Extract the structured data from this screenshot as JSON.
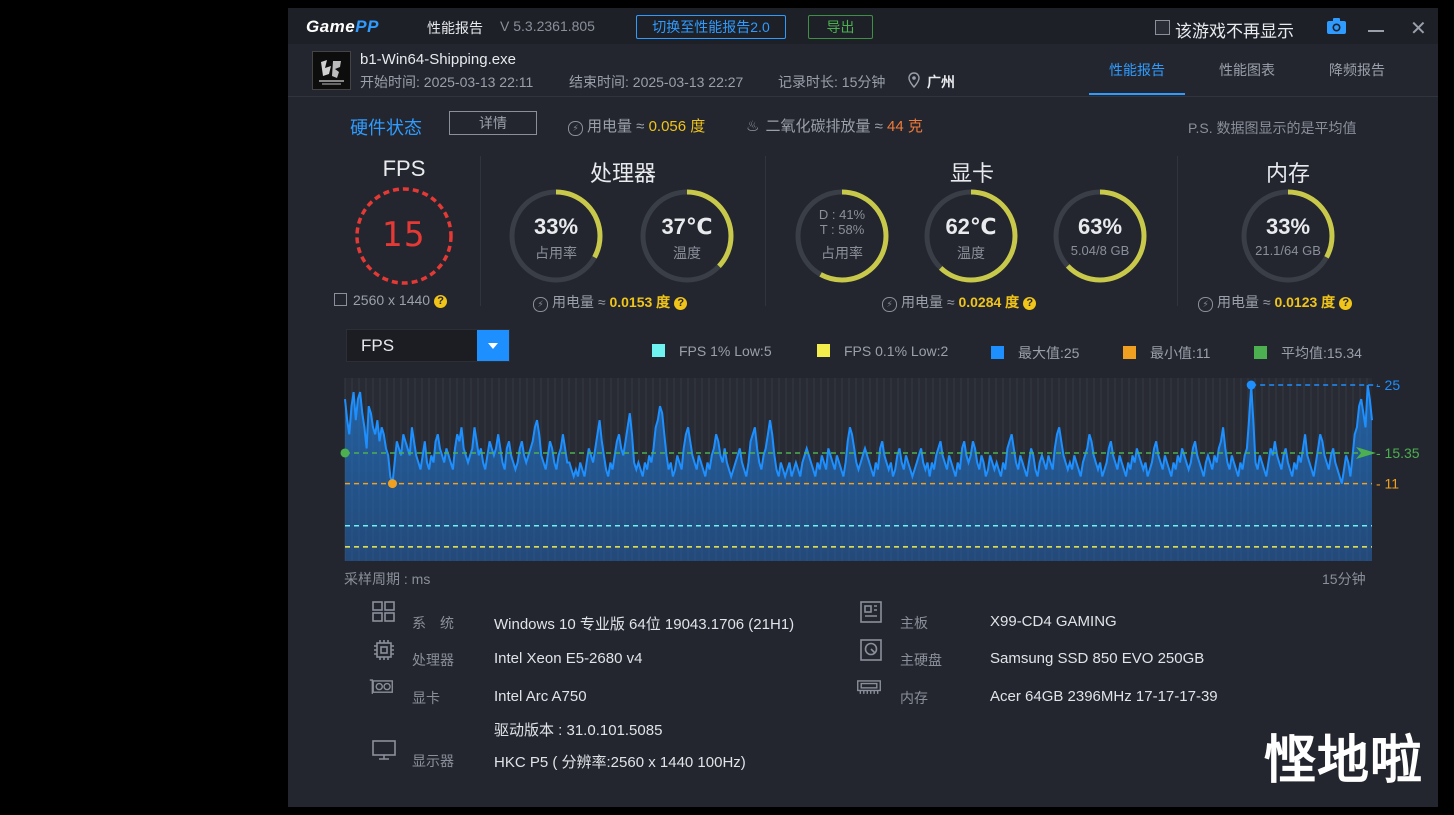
{
  "app": {
    "logo_a": "Game",
    "logo_b": "PP",
    "title": "性能报告",
    "version": "V 5.3.2361.805",
    "switch_label": "切换至性能报告2.0",
    "export_label": "导出",
    "hide_label": "该游戏不再显示",
    "close_glyph": "✕"
  },
  "game": {
    "name": "b1-Win64-Shipping.exe",
    "start": "开始时间: 2025-03-13 22:11",
    "end": "结束时间: 2025-03-13 22:27",
    "duration": "记录时长: 15分钟",
    "location": "广州"
  },
  "tabs": [
    {
      "label": "性能报告",
      "active": true
    },
    {
      "label": "性能图表",
      "active": false
    },
    {
      "label": "降频报告",
      "active": false
    }
  ],
  "hardware": {
    "title": "硬件状态",
    "detail_label": "详情",
    "power_prefix": "用电量 ≈ ",
    "power_value": "0.056 度",
    "co2_prefix": "二氧化碳排放量 ≈ ",
    "co2_value": "44 克",
    "note": "P.S. 数据图显示的是平均值"
  },
  "fps_panel": {
    "title": "FPS",
    "value": "15",
    "resolution": "2560 x 1440"
  },
  "cpu_panel": {
    "title": "处理器",
    "usage_value": "33%",
    "usage_label": "占用率",
    "usage_frac": 0.33,
    "temp_value": "37℃",
    "temp_label": "温度",
    "temp_frac": 0.37,
    "power_prefix": "用电量 ≈ ",
    "power_value": "0.0153 度"
  },
  "gpu_panel": {
    "title": "显卡",
    "d_usage": "D : 41%",
    "t_usage": "T : 58%",
    "usage_label": "占用率",
    "usage_frac": 0.58,
    "temp_value": "62℃",
    "temp_label": "温度",
    "temp_frac": 0.62,
    "mem_value": "63%",
    "mem_label": "5.04/8 GB",
    "mem_frac": 0.63,
    "power_prefix": "用电量 ≈ ",
    "power_value": "0.0284 度"
  },
  "mem_panel": {
    "title": "内存",
    "value": "33%",
    "label": "21.1/64 GB",
    "frac": 0.33,
    "power_prefix": "用电量 ≈ ",
    "power_value": "0.0123 度"
  },
  "chart_select": {
    "value": "FPS"
  },
  "legend": [
    {
      "label": "FPS 1% Low:5",
      "color": "#6ff3f0"
    },
    {
      "label": "FPS 0.1% Low:2",
      "color": "#f4ee4c"
    },
    {
      "label": "最大值:25",
      "color": "#1e8fff"
    },
    {
      "label": "最小值:11",
      "color": "#f0a020"
    },
    {
      "label": "平均值:15.34",
      "color": "#4caf50"
    }
  ],
  "chart_data": {
    "type": "area",
    "title": "",
    "xlabel": "采样周期 : ms",
    "x_end_label": "15分钟",
    "ylim": [
      0,
      26
    ],
    "marker_labels": {
      "max": "25",
      "avg": "15.35",
      "min": "11"
    },
    "reference_lines": {
      "max": 25,
      "avg": 15.35,
      "min": 11,
      "low1": 5,
      "low01": 2
    },
    "colors": {
      "line": "#1e8fff",
      "avg": "#4caf50",
      "min": "#f0a020",
      "low1": "#6ff3f0",
      "low01": "#f4ee4c"
    },
    "values": [
      23,
      20,
      18,
      22,
      24,
      20,
      23,
      24,
      21,
      19,
      16,
      22,
      21,
      19,
      18,
      20,
      17,
      19,
      18,
      16,
      15,
      12,
      11,
      14,
      17,
      16,
      15,
      18,
      17,
      16,
      15,
      19,
      17,
      15,
      14,
      13,
      15,
      17,
      14,
      13,
      15,
      14,
      17,
      18,
      16,
      15,
      14,
      16,
      15,
      14,
      13,
      16,
      18,
      17,
      19,
      16,
      15,
      14,
      15,
      16,
      19,
      17,
      15,
      16,
      14,
      13,
      15,
      17,
      16,
      15,
      16,
      18,
      16,
      14,
      13,
      16,
      17,
      15,
      14,
      13,
      14,
      16,
      17,
      15,
      14,
      15,
      16,
      17,
      19,
      20,
      18,
      15,
      14,
      13,
      15,
      17,
      16,
      14,
      13,
      15,
      16,
      18,
      16,
      14,
      14,
      13,
      12,
      13,
      12,
      14,
      13,
      12,
      14,
      16,
      15,
      14,
      16,
      18,
      20,
      17,
      15,
      13,
      12,
      14,
      13,
      15,
      17,
      18,
      16,
      15,
      17,
      19,
      21,
      18,
      14,
      13,
      14,
      13,
      12,
      14,
      13,
      15,
      14,
      16,
      19,
      20,
      22,
      21,
      18,
      15,
      13,
      14,
      12,
      13,
      15,
      14,
      13,
      16,
      18,
      19,
      17,
      15,
      14,
      13,
      15,
      14,
      13,
      12,
      14,
      13,
      15,
      16,
      18,
      17,
      15,
      14,
      16,
      14,
      13,
      12,
      13,
      14,
      15,
      16,
      14,
      13,
      12,
      14,
      17,
      18,
      19,
      16,
      14,
      13,
      15,
      16,
      18,
      20,
      18,
      15,
      13,
      12,
      14,
      13,
      12,
      13,
      14,
      12,
      13,
      14,
      13,
      12,
      14,
      15,
      16,
      15,
      14,
      13,
      12,
      14,
      13,
      15,
      14,
      13,
      16,
      15,
      14,
      13,
      15,
      14,
      13,
      12,
      14,
      17,
      19,
      18,
      16,
      14,
      13,
      14,
      15,
      16,
      15,
      14,
      13,
      12,
      14,
      13,
      16,
      17,
      15,
      14,
      13,
      14,
      12,
      13,
      15,
      16,
      14,
      13,
      15,
      14,
      13,
      12,
      13,
      14,
      15,
      16,
      14,
      13,
      14,
      12,
      14,
      13,
      15,
      16,
      17,
      15,
      14,
      13,
      15,
      14,
      13,
      12,
      14,
      13,
      16,
      17,
      15,
      14,
      15,
      17,
      16,
      14,
      13,
      15,
      14,
      12,
      13,
      15,
      14,
      13,
      14,
      13,
      12,
      14,
      13,
      16,
      17,
      18,
      16,
      14,
      13,
      15,
      14,
      13,
      12,
      14,
      16,
      15,
      13,
      12,
      14,
      15,
      14,
      13,
      15,
      14,
      13,
      16,
      18,
      19,
      17,
      15,
      14,
      13,
      14,
      13,
      15,
      14,
      13,
      12,
      14,
      15,
      16,
      18,
      17,
      15,
      14,
      13,
      14,
      12,
      13,
      14,
      16,
      17,
      15,
      14,
      13,
      15,
      14,
      13,
      12,
      14,
      13,
      15,
      14,
      16,
      15,
      14,
      13,
      14,
      12,
      13,
      14,
      16,
      17,
      15,
      14,
      13,
      15,
      14,
      13,
      12,
      14,
      13,
      15,
      14,
      16,
      15,
      14,
      13,
      14,
      16,
      17,
      15,
      14,
      13,
      12,
      14,
      15,
      14,
      13,
      15,
      14,
      16,
      17,
      19,
      16,
      14,
      13,
      15,
      14,
      13,
      12,
      14,
      13,
      15,
      16,
      20,
      25,
      20,
      14,
      13,
      15,
      14,
      13,
      12,
      14,
      16,
      15,
      17,
      15,
      14,
      13,
      15,
      16,
      14,
      13,
      12,
      14,
      13,
      15,
      14,
      16,
      18,
      15,
      14,
      13,
      12,
      14,
      16,
      18,
      17,
      15,
      14,
      13,
      15,
      16,
      14,
      13,
      12,
      11,
      13,
      15,
      14,
      12,
      15,
      18,
      19,
      22,
      23,
      21,
      19,
      25,
      23,
      20
    ]
  },
  "system": [
    {
      "key": "系　统",
      "value": "Windows 10 专业版 64位 19043.1706 (21H1)"
    },
    {
      "key": "处理器",
      "value": "Intel Xeon E5-2680 v4"
    },
    {
      "key": "显卡",
      "value": "Intel Arc A750"
    },
    {
      "key": "",
      "value": "驱动版本 : 31.0.101.5085"
    },
    {
      "key": "显示器",
      "value": "HKC P5 ( 分辨率:2560 x 1440 100Hz)"
    },
    {
      "key": "主板",
      "value": "X99-CD4 GAMING"
    },
    {
      "key": "主硬盘",
      "value": "Samsung SSD 850 EVO 250GB"
    },
    {
      "key": "内存",
      "value": "Acer 64GB 2396MHz 17-17-17-39"
    }
  ],
  "watermark": "悭地啦"
}
